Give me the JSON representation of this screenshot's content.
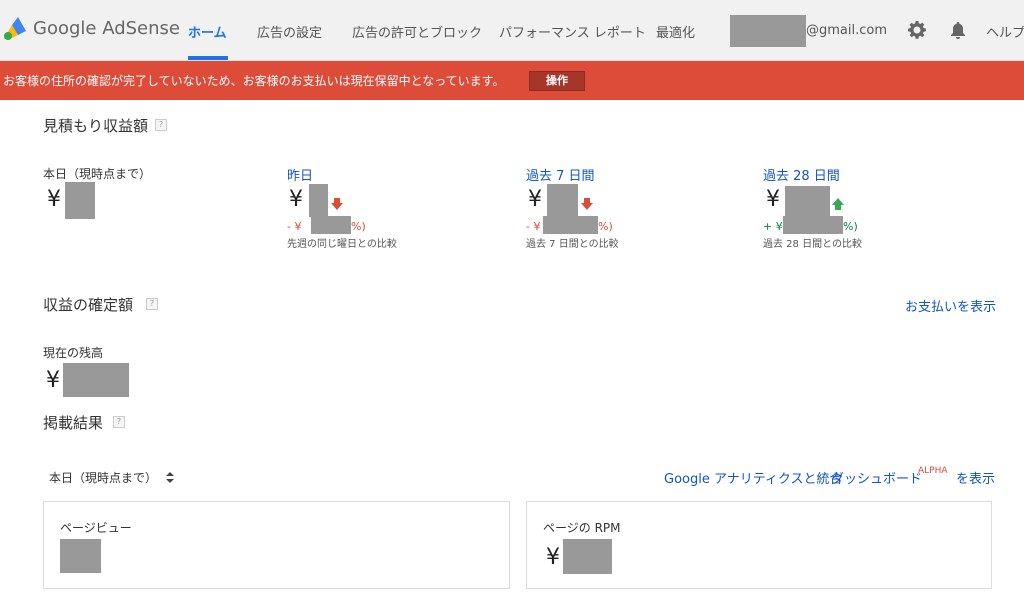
{
  "header": {
    "logo_text": "Google AdSense",
    "tabs": [
      {
        "label": "ホーム",
        "active": true
      },
      {
        "label": "広告の設定"
      },
      {
        "label": "広告の許可とブロック"
      },
      {
        "label": "パフォーマンス レポート"
      },
      {
        "label": "最適化"
      }
    ],
    "email_suffix": "@gmail.com",
    "help_label": "ヘルプ",
    "accent": "#1a73e8"
  },
  "alert": {
    "message": "お客様の住所の確認が完了していないため、お客様のお支払いは現在保留中となっています。",
    "action_label": "操作",
    "color": "#dd4b39"
  },
  "estimated": {
    "title": "見積もり収益額",
    "help": "?",
    "today": {
      "label": "本日（現時点まで）",
      "currency": "¥"
    },
    "yesterday": {
      "label": "昨日",
      "currency": "¥",
      "change_prefix": "- ¥",
      "change_suffix": "%)",
      "comparison": "先週の同じ曜日との比較"
    },
    "last7": {
      "label": "過去 7 日間",
      "currency": "¥",
      "change_prefix": "- ¥",
      "change_suffix": "%)",
      "comparison": "過去 7 日間との比較"
    },
    "last28": {
      "label": "過去 28 日間",
      "currency": "¥",
      "change_prefix": "+ ¥",
      "change_suffix": "%)",
      "comparison": "過去 28 日間との比較"
    }
  },
  "finalized": {
    "title": "収益の確定額",
    "help": "?",
    "view_payments": "お支払いを表示",
    "balance_label": "現在の残高",
    "currency": "¥"
  },
  "performance": {
    "title": "掲載結果",
    "help": "?",
    "period_selector": "本日（現時点まで）",
    "analytics_link": "Google アナリティクスと統合",
    "dashboard_label": "ダッシュボード",
    "alpha_badge": "ALPHA",
    "show_link": "を表示",
    "cards": [
      {
        "label": "ページビュー"
      },
      {
        "label": "ページの RPM",
        "currency": "¥"
      }
    ]
  }
}
